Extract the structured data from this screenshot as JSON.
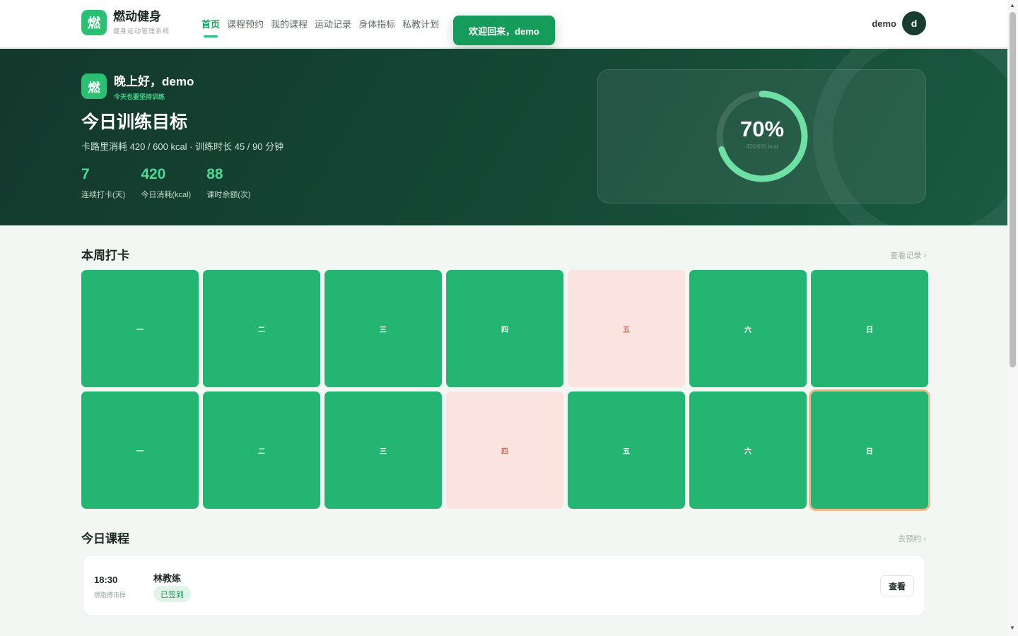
{
  "header": {
    "logo_char": "燃",
    "brand_name": "燃动健身",
    "brand_sub": "健身运动管理系统",
    "nav": [
      "首页",
      "课程预约",
      "我的课程",
      "运动记录",
      "身体指标",
      "私教计划"
    ],
    "active_nav": "首页",
    "user_name": "demo",
    "avatar_letter": "d"
  },
  "toast": {
    "message": "欢迎回来，demo"
  },
  "hero": {
    "logo_char": "燃",
    "greeting": "晚上好，demo",
    "greeting_sub": "今天也要坚持训练",
    "goal_title": "今日训练目标",
    "goal_desc": "卡路里消耗 420 / 600 kcal · 训练时长 45 / 90 分钟",
    "stats": [
      {
        "value": "7",
        "label": "连续打卡(天)"
      },
      {
        "value": "420",
        "label": "今日消耗(kcal)"
      },
      {
        "value": "88",
        "label": "课时余额(次)"
      }
    ],
    "progress": {
      "percent": 70,
      "percent_label": "70%",
      "sub": "420/600 kcal"
    }
  },
  "checkin": {
    "title": "本周打卡",
    "link": "查看记录 ›",
    "days": [
      {
        "label": "一",
        "status": "done"
      },
      {
        "label": "二",
        "status": "done"
      },
      {
        "label": "三",
        "status": "done"
      },
      {
        "label": "四",
        "status": "done"
      },
      {
        "label": "五",
        "status": "missed"
      },
      {
        "label": "六",
        "status": "done"
      },
      {
        "label": "日",
        "status": "done"
      },
      {
        "label": "一",
        "status": "done"
      },
      {
        "label": "二",
        "status": "done"
      },
      {
        "label": "三",
        "status": "done"
      },
      {
        "label": "四",
        "status": "missed"
      },
      {
        "label": "五",
        "status": "done"
      },
      {
        "label": "六",
        "status": "done"
      },
      {
        "label": "日",
        "status": "today"
      }
    ]
  },
  "courses": {
    "title": "今日课程",
    "link": "去预约 ›",
    "items": [
      {
        "time": "18:30",
        "place": "燃脂搏击操",
        "coach": "林教练",
        "status": "已签到",
        "action": "查看"
      }
    ]
  },
  "colors": {
    "accent": "#2bbf74",
    "hero_bg": "#13382c",
    "done": "#25b572",
    "missed": "#fbe3df",
    "today_border": "#f0b98d"
  }
}
